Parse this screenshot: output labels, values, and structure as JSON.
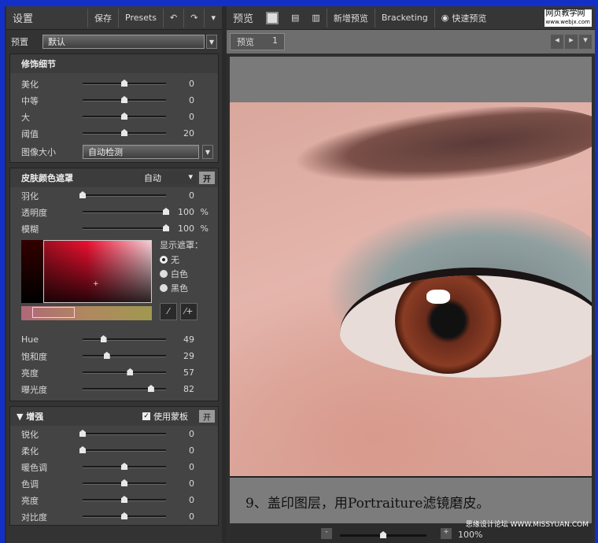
{
  "left": {
    "title": "设置",
    "save": "保存",
    "presets": "Presets",
    "preset_label": "预置",
    "preset_value": "默认",
    "detail": {
      "title": "修饰细节",
      "sliders": [
        {
          "label": "美化",
          "value": "0",
          "pos": 0.5
        },
        {
          "label": "中等",
          "value": "0",
          "pos": 0.5
        },
        {
          "label": "大",
          "value": "0",
          "pos": 0.5
        },
        {
          "label": "阈值",
          "value": "20",
          "pos": 0.5
        }
      ],
      "size_label": "图像大小",
      "size_value": "自动检测"
    },
    "mask": {
      "title": "皮肤颜色遮罩",
      "mode": "自动",
      "on": "开",
      "sliders": [
        {
          "label": "羽化",
          "value": "0",
          "pos": 0
        },
        {
          "label": "透明度",
          "value": "100",
          "pos": 1,
          "unit": "%"
        },
        {
          "label": "模糊",
          "value": "100",
          "pos": 1,
          "unit": "%"
        }
      ],
      "show_label": "显示遮罩：",
      "options": [
        "无",
        "白色",
        "黑色"
      ],
      "sliders2": [
        {
          "label": "Hue",
          "value": "49",
          "pos": 0.25
        },
        {
          "label": "饱和度",
          "value": "29",
          "pos": 0.29
        },
        {
          "label": "亮度",
          "value": "57",
          "pos": 0.57
        },
        {
          "label": "曝光度",
          "value": "82",
          "pos": 0.82
        }
      ]
    },
    "enhance": {
      "title": "增强",
      "use_mask": "使用蒙板",
      "on": "开",
      "sliders": [
        {
          "label": "锐化",
          "value": "0",
          "pos": 0
        },
        {
          "label": "柔化",
          "value": "0",
          "pos": 0
        },
        {
          "label": "暖色调",
          "value": "0",
          "pos": 0.5
        },
        {
          "label": "色调",
          "value": "0",
          "pos": 0.5
        },
        {
          "label": "亮度",
          "value": "0",
          "pos": 0.5
        },
        {
          "label": "对比度",
          "value": "0",
          "pos": 0.5
        }
      ]
    }
  },
  "right": {
    "title": "预览",
    "new_preview": "新增预览",
    "bracketing": "Bracketing",
    "quick": "快速预览",
    "tab": "预览",
    "tab_num": "1",
    "caption": "9、盖印图层，用Portraiture滤镜磨皮。",
    "zoom": "100%",
    "watermark1": "网页教学网",
    "watermark1b": "www.webjx.com",
    "watermark2": "思缘设计论坛 WWW.MISSYUAN.COM"
  },
  "colors": {
    "frame": "#1230c8"
  }
}
